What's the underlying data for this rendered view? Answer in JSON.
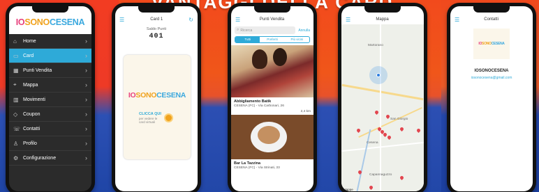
{
  "banner": {
    "text": "VANTAGGI DELLA CARD"
  },
  "logo": {
    "io": "IO",
    "sono": "SONO",
    "cesena": "CESENA"
  },
  "menu": {
    "items": [
      {
        "label": "Home",
        "icon": "home-icon",
        "glyph": "⌂",
        "active": false
      },
      {
        "label": "Card",
        "icon": "card-icon",
        "glyph": "▭",
        "active": true
      },
      {
        "label": "Punti Vendita",
        "icon": "store-icon",
        "glyph": "▦",
        "active": false
      },
      {
        "label": "Mappa",
        "icon": "map-icon",
        "glyph": "⌖",
        "active": false
      },
      {
        "label": "Movimenti",
        "icon": "chart-icon",
        "glyph": "▥",
        "active": false
      },
      {
        "label": "Coupon",
        "icon": "tag-icon",
        "glyph": "◇",
        "active": false
      },
      {
        "label": "Contatti",
        "icon": "phone-icon",
        "glyph": "☏",
        "active": false
      },
      {
        "label": "Profilo",
        "icon": "user-icon",
        "glyph": "♙",
        "active": false
      },
      {
        "label": "Configurazione",
        "icon": "gear-icon",
        "glyph": "⚙",
        "active": false
      }
    ],
    "chevron": "›"
  },
  "card_screen": {
    "title": "Card 1",
    "saldo_label": "Saldo Punti",
    "saldo_value": "401",
    "cta_main": "CLICCA QUI",
    "cta_sub1": "per vedere le",
    "cta_sub2": "card virtuali"
  },
  "stores_screen": {
    "title": "Punti Vendita",
    "search_placeholder": "Ricerca",
    "search_cancel": "Annulla",
    "tabs": [
      {
        "label": "Tutti",
        "active": true
      },
      {
        "label": "Preferiti",
        "active": false
      },
      {
        "label": "Più vicini",
        "active": false
      }
    ],
    "stores": [
      {
        "name": "Abbigliamento Batik",
        "address": "CESENA (FC) - Via Carbonari, 26",
        "distance": "2,4 km"
      },
      {
        "name": "Bar La Tazzina",
        "address": "CESENA (FC) - Via Strinati, 33",
        "distance": ""
      }
    ]
  },
  "map_screen": {
    "title": "Mappa",
    "labels": [
      "Martorano",
      "Cesena",
      "Capannaguzzo",
      "San Giorgio"
    ],
    "credit": "Mappe"
  },
  "contacts_screen": {
    "title": "Contatti",
    "name": "IOSONOCESENA",
    "email": "iosonocesena@gmail.com"
  },
  "colors": {
    "accent": "#2eaad8",
    "logo_pink": "#e8417d",
    "logo_orange": "#f0a21d",
    "logo_blue": "#3aa8de",
    "bg_top": "#f24a1c",
    "bg_bottom": "#2247a8"
  }
}
